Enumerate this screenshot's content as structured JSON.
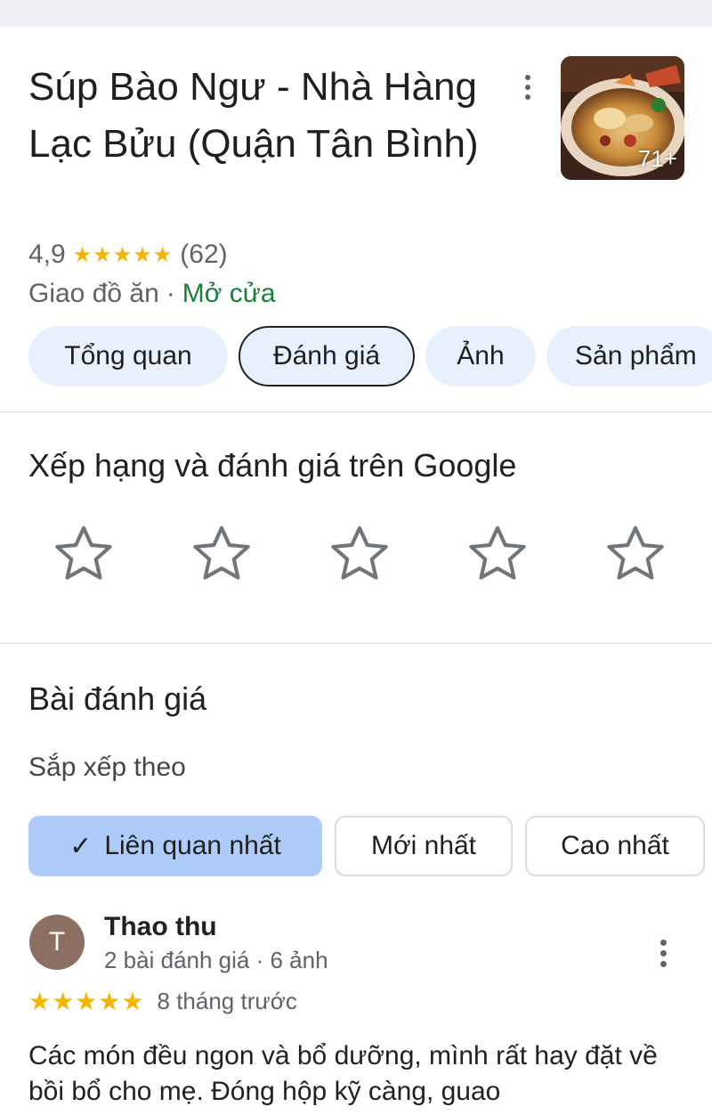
{
  "place": {
    "title": "Súp Bào Ngư - Nhà Hàng Lạc Bửu (Quận Tân Bình)",
    "photo_count": "71+",
    "rating": "4,9",
    "stars": "★★★★★",
    "review_count": "(62)",
    "category": "Giao đồ ăn",
    "separator": "·",
    "status": "Mở cửa",
    "status_color": "#188038"
  },
  "tabs": [
    {
      "label": "Tổng quan"
    },
    {
      "label": "Đánh giá"
    },
    {
      "label": "Ảnh"
    },
    {
      "label": "Sản phẩm"
    }
  ],
  "rate_section": {
    "title": "Xếp hạng và đánh giá trên Google",
    "star_icon": "star-outline-icon"
  },
  "reviews_section": {
    "title": "Bài đánh giá",
    "sort_label": "Sắp xếp theo",
    "sort_options": [
      {
        "label": "Liên quan nhất",
        "check": "✓"
      },
      {
        "label": "Mới nhất"
      },
      {
        "label": "Cao nhất"
      }
    ]
  },
  "review": {
    "avatar_letter": "T",
    "name": "Thao thu",
    "meta": "2 bài đánh giá · 6 ảnh",
    "stars": "★★★★★",
    "time": "8 tháng trước",
    "text": "Các món đều ngon và bổ dưỡng, mình rất hay đặt về bồi bổ cho mẹ. Đóng hộp kỹ càng, guao"
  },
  "colors": {
    "accent_chip": "#aecbfa",
    "tab_bg": "#e8f0fe",
    "star": "#f4b400",
    "avatar": "#8d6e63"
  }
}
